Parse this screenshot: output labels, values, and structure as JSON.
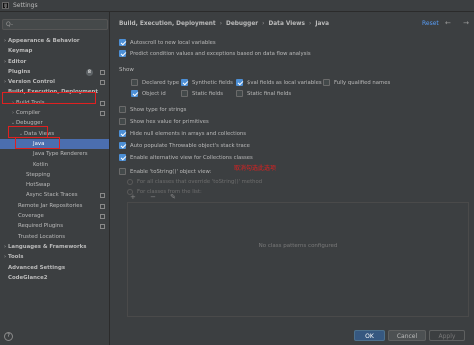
{
  "window": {
    "title": "Settings",
    "app_icon": "IJ"
  },
  "search": {
    "placeholder": "Q-"
  },
  "sidebar": {
    "items": [
      {
        "label": "Appearance & Behavior",
        "arrow": "›"
      },
      {
        "label": "Keymap",
        "arrow": ""
      },
      {
        "label": "Editor",
        "arrow": "›"
      },
      {
        "label": "Plugins",
        "arrow": "",
        "badge": "8"
      },
      {
        "label": "Version Control",
        "arrow": "›"
      },
      {
        "label": "Build, Execution, Deployment",
        "arrow": "⌄"
      },
      {
        "label": "Build Tools",
        "arrow": "›"
      },
      {
        "label": "Compiler",
        "arrow": "›"
      },
      {
        "label": "Debugger",
        "arrow": "⌄"
      },
      {
        "label": "Data Views",
        "arrow": "⌄"
      },
      {
        "label": "Java",
        "arrow": ""
      },
      {
        "label": "Java Type Renderers",
        "arrow": ""
      },
      {
        "label": "Kotlin",
        "arrow": ""
      },
      {
        "label": "Stepping",
        "arrow": ""
      },
      {
        "label": "HotSwap",
        "arrow": ""
      },
      {
        "label": "Async Stack Traces",
        "arrow": ""
      },
      {
        "label": "Remote Jar Repositories",
        "arrow": ""
      },
      {
        "label": "Coverage",
        "arrow": ""
      },
      {
        "label": "Required Plugins",
        "arrow": ""
      },
      {
        "label": "Trusted Locations",
        "arrow": ""
      },
      {
        "label": "Languages & Frameworks",
        "arrow": "›"
      },
      {
        "label": "Tools",
        "arrow": "›"
      },
      {
        "label": "Advanced Settings",
        "arrow": ""
      },
      {
        "label": "CodeGlance2",
        "arrow": ""
      }
    ]
  },
  "breadcrumb": [
    "Build, Execution, Deployment",
    "Debugger",
    "Data Views",
    "Java"
  ],
  "header": {
    "reset_label": "Reset",
    "nav": "← →"
  },
  "options": {
    "autoscroll": {
      "label": "Autoscroll to new local variables",
      "checked": true
    },
    "predict": {
      "label": "Predict condition values and exceptions based on data flow analysis",
      "checked": true
    },
    "show_label": "Show",
    "declared_type": {
      "label": "Declared type",
      "checked": false
    },
    "synthetic_fields": {
      "label": "Synthetic fields",
      "checked": true
    },
    "val_fields": {
      "label": "$val fields as local variables",
      "checked": true
    },
    "fq_names": {
      "label": "Fully qualified names",
      "checked": false
    },
    "object_id": {
      "label": "Object id",
      "checked": true
    },
    "static_fields": {
      "label": "Static fields",
      "checked": false
    },
    "static_final_fields": {
      "label": "Static final fields",
      "checked": false
    },
    "type_strings": {
      "label": "Show type for strings",
      "checked": false
    },
    "hex_primitives": {
      "label": "Show hex value for primitives",
      "checked": false
    },
    "hide_null": {
      "label": "Hide null elements in arrays and collections",
      "checked": true
    },
    "auto_populate": {
      "label": "Auto populate Throwable object's stack trace",
      "checked": true
    },
    "alt_view": {
      "label": "Enable alternative view for Collections classes",
      "checked": true
    },
    "tostring": {
      "label": "Enable 'toString()' object view:",
      "checked": false
    },
    "all_classes": {
      "label": "For all classes that override 'toString()' method"
    },
    "classes_list": {
      "label": "For classes from the list:"
    }
  },
  "annotation": {
    "text": "取消勾选此选项"
  },
  "list": {
    "toolbar": "+ − ✎",
    "empty_text": "No class patterns configured"
  },
  "footer": {
    "help": "?",
    "ok": "OK",
    "cancel": "Cancel",
    "apply": "Apply"
  },
  "colors": {
    "accent": "#4b6eaf",
    "highlight_box": "#e02020",
    "link": "#589df6"
  }
}
